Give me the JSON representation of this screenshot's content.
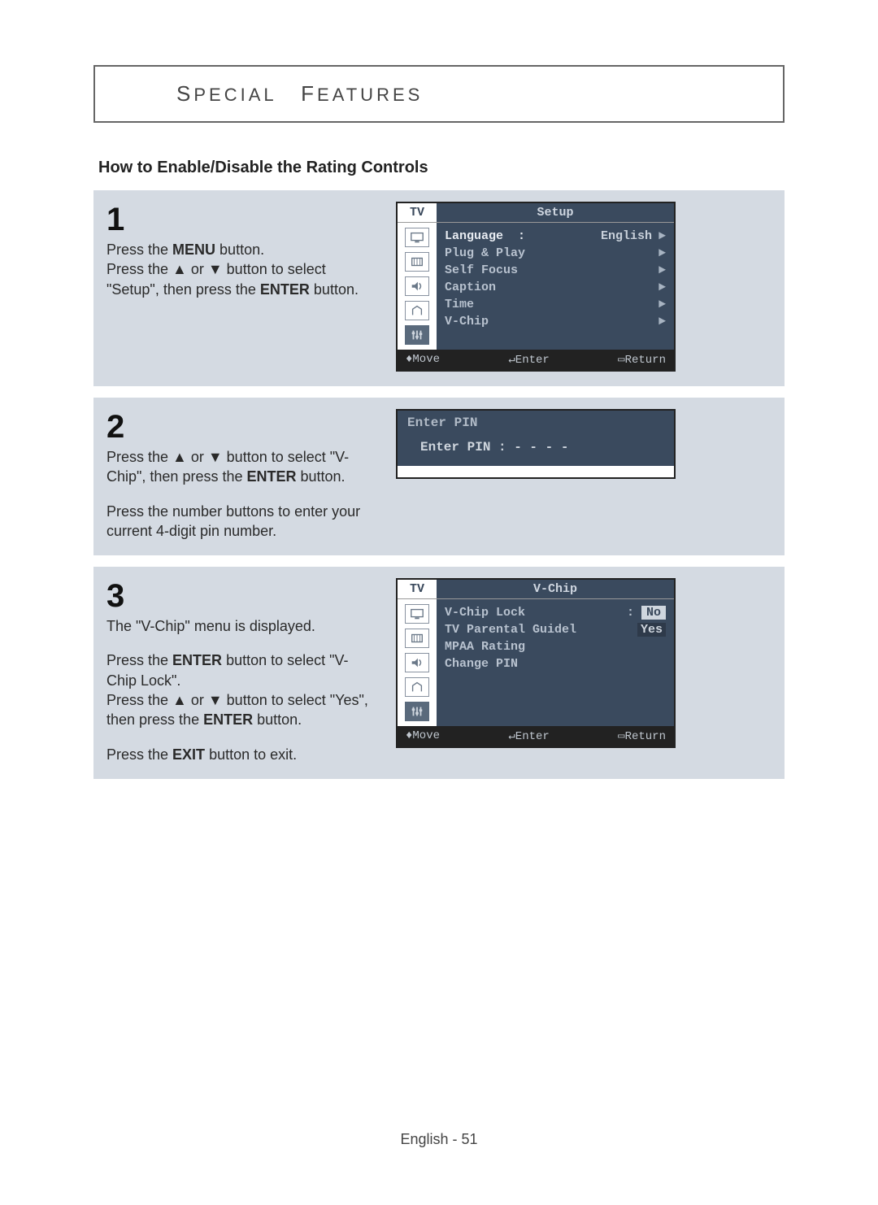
{
  "header": {
    "word1_cap": "S",
    "word1_rest": "PECIAL",
    "word2_cap": "F",
    "word2_rest": "EATURES"
  },
  "section_title": "How to Enable/Disable the Rating Controls",
  "steps": {
    "s1": {
      "num": "1",
      "line1a": "Press the ",
      "line1b": "MENU",
      "line1c": " button.",
      "line2a": "Press the ▲ or ▼ button to select \"Setup\", then press the ",
      "line2b": "ENTER",
      "line2c": " button."
    },
    "s2": {
      "num": "2",
      "line1a": "Press the ▲ or ▼ button to select \"V-Chip\", then press the ",
      "line1b": "ENTER",
      "line1c": " button.",
      "line2": "Press the number buttons to enter your current 4-digit pin number."
    },
    "s3": {
      "num": "3",
      "line1": "The \"V-Chip\" menu is displayed.",
      "line2a": "Press the ",
      "line2b": "ENTER",
      "line2c": " button to select \"V-Chip Lock\".",
      "line3a": "Press the ▲ or ▼ button to select \"Yes\", then press the ",
      "line3b": "ENTER",
      "line3c": " button.",
      "line4a": "Press the ",
      "line4b": "EXIT",
      "line4c": " button to exit."
    }
  },
  "osd1": {
    "tv": "TV",
    "title": "Setup",
    "rows": [
      {
        "label": "Language  :",
        "value": "English",
        "arrow": "►"
      },
      {
        "label": "Plug & Play",
        "value": "",
        "arrow": "►"
      },
      {
        "label": "Self Focus",
        "value": "",
        "arrow": "►"
      },
      {
        "label": "Caption",
        "value": "",
        "arrow": "►"
      },
      {
        "label": "Time",
        "value": "",
        "arrow": "►"
      },
      {
        "label": "V-Chip",
        "value": "",
        "arrow": "►"
      }
    ],
    "foot": {
      "move": "♦Move",
      "enter": "↵Enter",
      "return": "▭Return"
    }
  },
  "osd2": {
    "title": "Enter PIN",
    "row": "Enter PIN      : - - - -"
  },
  "osd3": {
    "tv": "TV",
    "title": "V-Chip",
    "rows": [
      {
        "label": "V-Chip Lock",
        "sep": ":",
        "value": "No",
        "hl": true
      },
      {
        "label": "TV Parental Guidel",
        "sep": "",
        "value": "Yes",
        "hl": false
      },
      {
        "label": "MPAA Rating",
        "sep": "",
        "value": "",
        "hl": false
      },
      {
        "label": "Change PIN",
        "sep": "",
        "value": "",
        "hl": false
      }
    ],
    "foot": {
      "move": "♦Move",
      "enter": "↵Enter",
      "return": "▭Return"
    }
  },
  "page_footer": "English - 51"
}
